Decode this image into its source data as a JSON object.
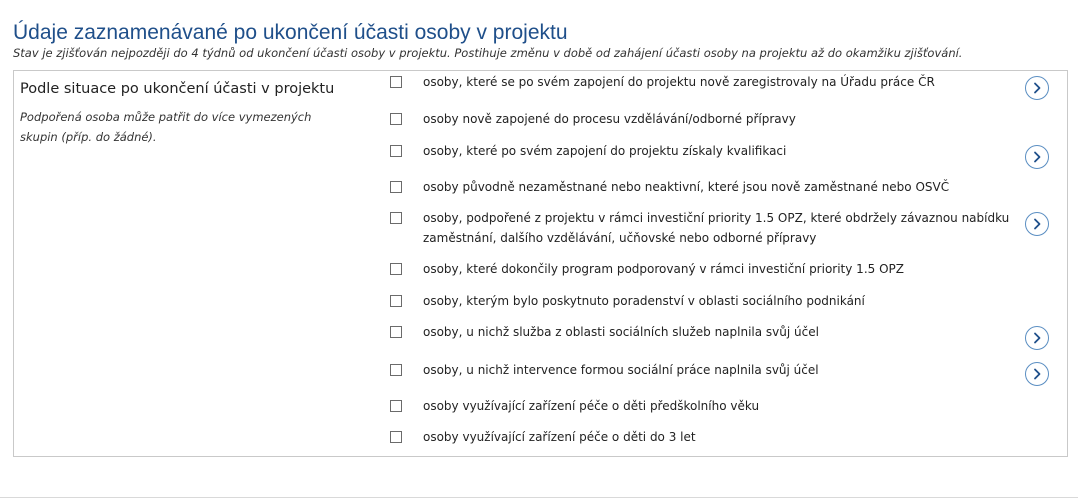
{
  "title": "Údaje zaznamenávané po ukončení účasti osoby v projektu",
  "subtitle": "Stav je zjišťován nejpozději do 4 týdnů od ukončení účasti osoby v projektu. Postihuje změnu v době od zahájení účasti osoby na projektu až do okamžiku zjišťování.",
  "section": {
    "label": "Podle situace po ukončení účasti v projektu",
    "note": "Podpořená osoba může patřit do více vymezených skupin (příp. do žádné)."
  },
  "icons": {
    "info": "chevron-right-circle-icon"
  },
  "colors": {
    "title": "#1f4f8a",
    "info_icon": "#5a8ec2"
  },
  "options": [
    {
      "label": "osoby, které se po svém zapojení do projektu nově zaregistrovaly na Úřadu práce ČR",
      "checked": false,
      "has_info": true
    },
    {
      "label": "osoby nově zapojené do procesu vzdělávání/odborné přípravy",
      "checked": false,
      "has_info": false
    },
    {
      "label": "osoby, které po svém zapojení do projektu získaly kvalifikaci",
      "checked": false,
      "has_info": true
    },
    {
      "label": "osoby původně nezaměstnané nebo neaktivní, které jsou nově zaměstnané nebo OSVČ",
      "checked": false,
      "has_info": false
    },
    {
      "label": "osoby, podpořené z projektu v rámci investiční priority 1.5 OPZ, které obdržely závaznou nabídku zaměstnání, dalšího vzdělávání, učňovské nebo odborné přípravy",
      "checked": false,
      "has_info": true
    },
    {
      "label": "osoby, které dokončily program podporovaný v rámci investiční priority 1.5 OPZ",
      "checked": false,
      "has_info": false
    },
    {
      "label": "osoby, kterým bylo poskytnuto poradenství v oblasti sociálního podnikání",
      "checked": false,
      "has_info": false
    },
    {
      "label": "osoby, u nichž služba z oblasti sociálních služeb naplnila svůj účel",
      "checked": false,
      "has_info": true
    },
    {
      "label": "osoby, u nichž intervence formou sociální práce naplnila svůj účel",
      "checked": false,
      "has_info": true
    },
    {
      "label": "osoby využívající zařízení péče o děti předškolního věku",
      "checked": false,
      "has_info": false
    },
    {
      "label": "osoby využívající zařízení péče o děti do 3 let",
      "checked": false,
      "has_info": false
    }
  ]
}
